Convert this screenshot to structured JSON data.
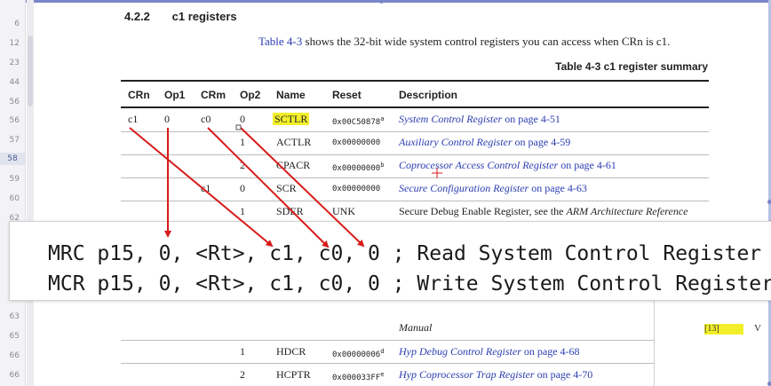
{
  "section": {
    "number": "4.2.2",
    "title": "c1 registers"
  },
  "intro": {
    "link": "Table 4-3",
    "text": " shows the 32-bit wide system control registers you can access when CRn is c1."
  },
  "table_caption": "Table 4-3 c1 register summary",
  "columns": [
    "CRn",
    "Op1",
    "CRm",
    "Op2",
    "Name",
    "Reset",
    "Description"
  ],
  "rows": [
    {
      "crn": "c1",
      "op1": "0",
      "crm": "c0",
      "op2": "0",
      "name": "SCTLR",
      "reset": "0x00C50878",
      "reset_note": "a",
      "desc_link": "System Control Register",
      "desc_suffix": " on page 4-51"
    },
    {
      "crn": "",
      "op1": "",
      "crm": "",
      "op2": "1",
      "name": "ACTLR",
      "reset": "0x00000000",
      "reset_note": "",
      "desc_link": "Auxiliary Control Register",
      "desc_suffix": " on page 4-59"
    },
    {
      "crn": "",
      "op1": "",
      "crm": "",
      "op2": "2",
      "name": "CPACR",
      "reset": "0x00000000",
      "reset_note": "b",
      "desc_link": "Coprocessor Access Control Register",
      "desc_suffix": " on page 4-61"
    },
    {
      "crn": "",
      "op1": "",
      "crm": "c1",
      "op2": "0",
      "name": "SCR",
      "reset": "0x00000000",
      "reset_note": "",
      "desc_link": "Secure Configuration Register",
      "desc_suffix": " on page 4-63"
    },
    {
      "crn": "",
      "op1": "",
      "crm": "",
      "op2": "1",
      "name": "SDER",
      "reset": "UNK",
      "reset_note": "",
      "desc_prefix": "Secure Debug Enable Register, see the ",
      "desc_italic": "ARM Architecture Reference"
    },
    {
      "desc_italic": "Manual"
    },
    {
      "crn": "",
      "op1": "",
      "crm": "",
      "op2": "1",
      "name": "HDCR",
      "reset": "0x00000006",
      "reset_note": "d",
      "desc_link": "Hyp Debug Control Register",
      "desc_suffix": " on page 4-68"
    },
    {
      "crn": "",
      "op1": "",
      "crm": "",
      "op2": "2",
      "name": "HCPTR",
      "reset": "0x000033FF",
      "reset_note": "e",
      "desc_link": "Hyp Coprocessor Trap Register",
      "desc_suffix": " on page 4-70"
    }
  ],
  "zoom_lines": [
    "MRC p15, 0, <Rt>, c1, c0, 0 ; Read System Control Register",
    "MCR p15, 0, <Rt>, c1, c0, 0 ; Write System Control Register"
  ],
  "right_pane": {
    "box_text": "[13]",
    "v_text": "V"
  },
  "gutter_lines": [
    "6",
    "12",
    "23",
    "44",
    "56",
    "56",
    "57",
    "58",
    "59",
    "60",
    "62",
    "63",
    "65",
    "66",
    "66"
  ],
  "colors": {
    "link": "#2a3cb0",
    "highlight": "#f2ef2a",
    "arrow": "#d81b1b"
  }
}
